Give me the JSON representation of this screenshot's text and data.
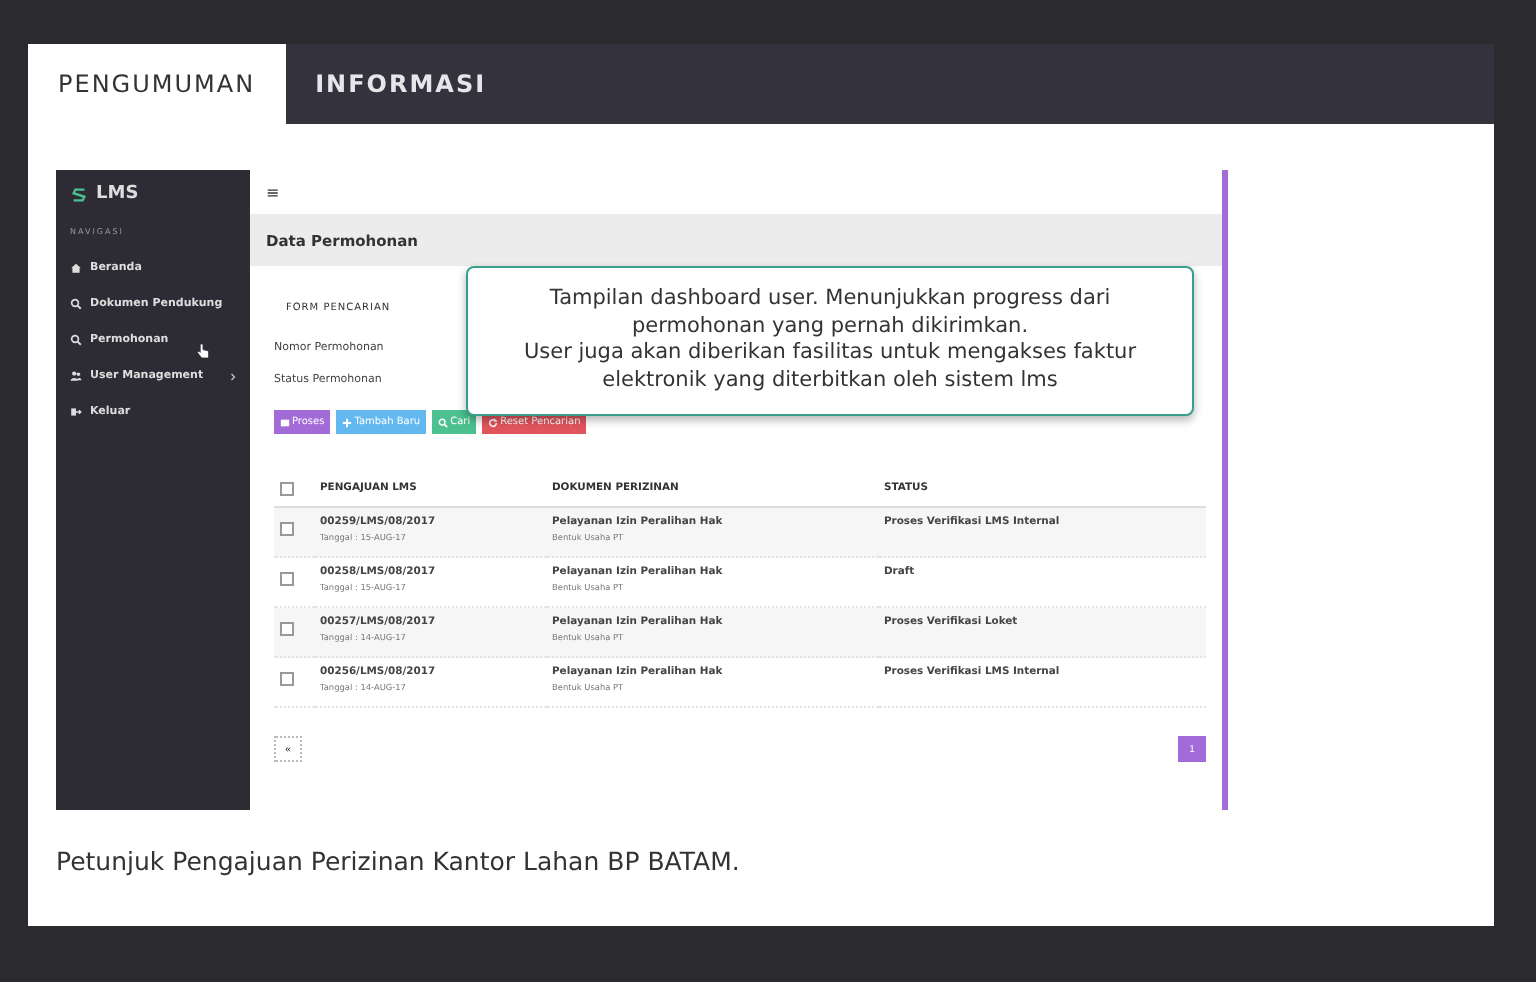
{
  "tabs": [
    {
      "label": "PENGUMUMAN",
      "selected": true
    },
    {
      "label": "INFORMASI",
      "selected": false
    }
  ],
  "screenshot": {
    "sidebar": {
      "logo": "LMS",
      "section": "NAVIGASI",
      "items": [
        {
          "label": "Beranda",
          "kind": "home",
          "selected": false,
          "has_submenu": false
        },
        {
          "label": "Dokumen Pendukung",
          "kind": "search",
          "selected": false,
          "has_submenu": false
        },
        {
          "label": "Permohonan",
          "kind": "search",
          "selected": false,
          "has_submenu": false
        },
        {
          "label": "User Management",
          "kind": "users",
          "selected": false,
          "has_submenu": true
        },
        {
          "label": "Keluar",
          "kind": "exit",
          "selected": false,
          "has_submenu": false
        }
      ]
    },
    "menu_glyph": "≡",
    "page_title": "Data Permohonan",
    "form": {
      "title": "FORM PENCARIAN",
      "fields": [
        "Nomor Permohonan",
        "Status Permohonan"
      ]
    },
    "buttons": [
      {
        "label": "Proses",
        "kind": "process",
        "color": "#a26bd6"
      },
      {
        "label": "Tambah Baru",
        "kind": "add",
        "color": "#63b9ef"
      },
      {
        "label": "Cari",
        "kind": "search",
        "color": "#4cc08f"
      },
      {
        "label": "Reset Pencarian",
        "kind": "reset",
        "color": "#e2545c"
      }
    ],
    "table": {
      "header_checked": false,
      "columns": [
        "PENGAJUAN LMS",
        "DOKUMEN PERIZINAN",
        "STATUS"
      ],
      "rows": [
        {
          "checked": false,
          "number": "00259/LMS/08/2017",
          "date": "Tanggal : 15-AUG-17",
          "document": "Pelayanan Izin Peralihan Hak",
          "document_sub": "Bentuk Usaha PT",
          "status": "Proses Verifikasi LMS Internal"
        },
        {
          "checked": false,
          "number": "00258/LMS/08/2017",
          "date": "Tanggal : 15-AUG-17",
          "document": "Pelayanan Izin Peralihan Hak",
          "document_sub": "Bentuk Usaha PT",
          "status": "Draft"
        },
        {
          "checked": false,
          "number": "00257/LMS/08/2017",
          "date": "Tanggal : 14-AUG-17",
          "document": "Pelayanan Izin Peralihan Hak",
          "document_sub": "Bentuk Usaha PT",
          "status": "Proses Verifikasi Loket"
        },
        {
          "checked": false,
          "number": "00256/LMS/08/2017",
          "date": "Tanggal : 14-AUG-17",
          "document": "Pelayanan Izin Peralihan Hak",
          "document_sub": "Bentuk Usaha PT",
          "status": "Proses Verifikasi LMS Internal"
        }
      ]
    },
    "pagination": {
      "prev": "«",
      "pages": [
        {
          "label": "1",
          "selected": true
        }
      ]
    },
    "tooltip": "Tampilan dashboard user. Menunjukkan progress dari permohonan yang pernah dikirimkan.\nUser juga akan diberikan fasilitas untuk mengakses faktur elektronik yang diterbitkan oleh sistem lms"
  },
  "caption": "Petunjuk Pengajuan Perizinan Kantor Lahan BP BATAM."
}
